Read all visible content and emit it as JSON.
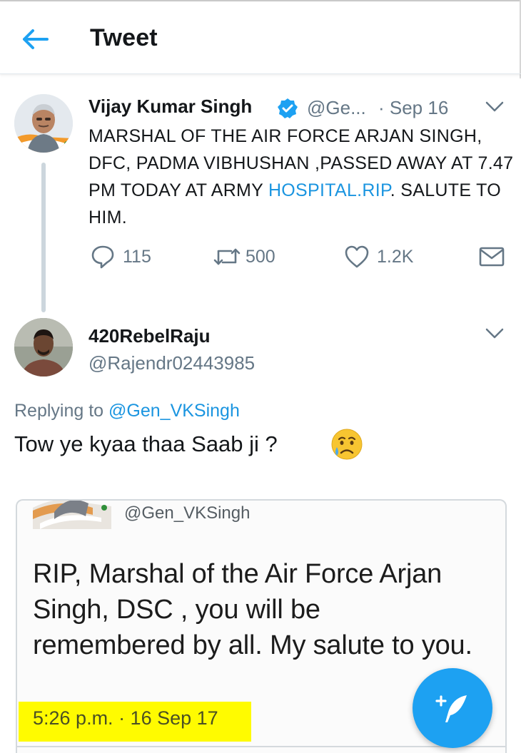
{
  "header": {
    "title": "Tweet",
    "back_icon": "arrow-left-icon"
  },
  "colors": {
    "twitter_blue": "#1da1f2",
    "link_blue": "#1b95e0",
    "secondary_text": "#657786",
    "highlight_yellow": "#fffb00"
  },
  "tweet": {
    "author_name": "Vijay Kumar Singh",
    "author_handle": "@Ge...",
    "date": "· Sep 16",
    "verified": true,
    "text_before_link": "MARSHAL OF THE AIR FORCE ARJAN SINGH, DFC, PADMA VIBHUSHAN ,PASSED AWAY AT 7.47  PM  TODAY AT ARMY ",
    "link_text": "HOSPITAL.RIP",
    "text_after_link": ". SALUTE TO HIM.",
    "replies": "115",
    "retweets": "500",
    "likes": "1.2K"
  },
  "reply": {
    "author_name": "420RebelRaju",
    "author_handle": "@Rajendr02443985",
    "replying_prefix": "Replying to",
    "replying_to": "@Gen_VKSingh",
    "text": "Tow ye kyaa thaa Saab ji ?",
    "emoji": "crying-face-icon"
  },
  "embedded": {
    "handle": "@Gen_VKSingh",
    "text": "RIP, Marshal of the Air Force Arjan Singh, DSC , you will be remembered by all. My salute to you.",
    "timestamp": "5:26 p.m. · 16 Sep 17"
  },
  "fab": {
    "icon": "compose-tweet-icon"
  }
}
